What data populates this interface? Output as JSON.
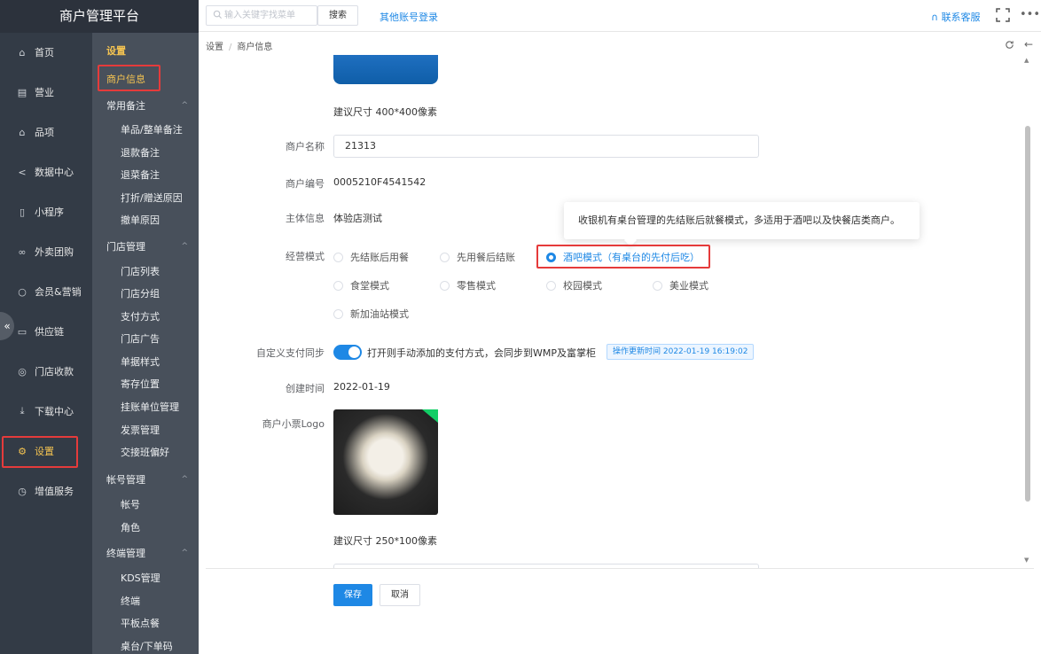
{
  "app_title": "商户管理平台",
  "topbar": {
    "search_placeholder": "输入关键字找菜单",
    "search_button": "搜索",
    "other_login": "其他账号登录",
    "contact": "联系客服",
    "more": "•••"
  },
  "sidebar": {
    "items": [
      {
        "label": "首页",
        "icon": "home-icon"
      },
      {
        "label": "营业",
        "icon": "calendar-icon"
      },
      {
        "label": "品项",
        "icon": "bag-icon"
      },
      {
        "label": "数据中心",
        "icon": "share-icon"
      },
      {
        "label": "小程序",
        "icon": "phone-icon"
      },
      {
        "label": "外卖团购",
        "icon": "bike-icon"
      },
      {
        "label": "会员&营销",
        "icon": "user-icon"
      },
      {
        "label": "供应链",
        "icon": "truck-icon"
      },
      {
        "label": "门店收款",
        "icon": "wallet-icon"
      },
      {
        "label": "下载中心",
        "icon": "download-icon"
      },
      {
        "label": "设置",
        "icon": "gear-icon"
      },
      {
        "label": "增值服务",
        "icon": "clock-icon"
      }
    ],
    "collapse": "«"
  },
  "submenu": {
    "title": "设置",
    "active": "商户信息",
    "groups": [
      {
        "label": "常用备注",
        "items": [
          "单品/整单备注",
          "退款备注",
          "退菜备注",
          "打折/赠送原因",
          "撤单原因"
        ]
      },
      {
        "label": "门店管理",
        "items": [
          "门店列表",
          "门店分组",
          "支付方式",
          "门店广告",
          "单据样式",
          "寄存位置",
          "挂账单位管理",
          "发票管理",
          "交接班偏好"
        ]
      },
      {
        "label": "帐号管理",
        "items": [
          "帐号",
          "角色"
        ]
      },
      {
        "label": "终端管理",
        "items": [
          "KDS管理",
          "终端",
          "平板点餐",
          "桌台/下单码"
        ]
      }
    ]
  },
  "breadcrumb": {
    "root": "设置",
    "sep": "/",
    "current": "商户信息"
  },
  "form": {
    "logo_hint": "建议尺寸 400*400像素",
    "name_label": "商户名称",
    "name_value": "21313",
    "code_label": "商户编号",
    "code_value": "0005210F4541542",
    "entity_label": "主体信息",
    "entity_value": "体验店测试",
    "mode_label": "经营模式",
    "modes": [
      "先结账后用餐",
      "先用餐后结账",
      "酒吧模式（有桌台的先付后吃）",
      "食堂模式",
      "零售模式",
      "校园模式",
      "美业模式",
      "新加油站模式"
    ],
    "selected_mode": "酒吧模式（有桌台的先付后吃）",
    "tooltip": "收银机有桌台管理的先结账后就餐模式，多适用于酒吧以及快餐店类商户。",
    "sync_label": "自定义支付同步",
    "sync_on": true,
    "sync_text": "打开则手动添加的支付方式，会同步到WMP及富掌柜",
    "sync_tag": "操作更新时间 2022-01-19 16:19:02",
    "created_label": "创建时间",
    "created_value": "2022-01-19",
    "ticket_logo_label": "商户小票Logo",
    "ticket_hint": "建议尺寸 250*100像素",
    "save": "保存",
    "cancel": "取消"
  },
  "colors": {
    "accent": "#1e88e5",
    "sidebar": "#333b46",
    "submenu": "#48505b",
    "active": "#f5c451",
    "highlight": "#e53b3b"
  }
}
